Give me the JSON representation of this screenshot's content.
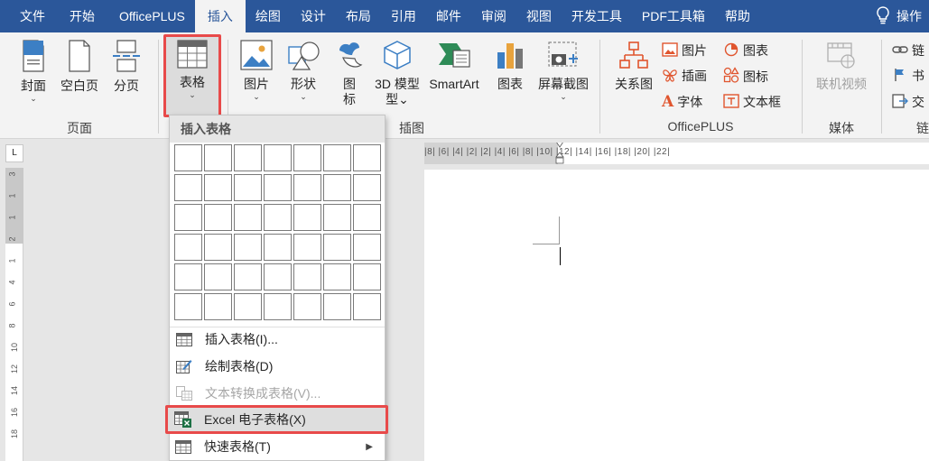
{
  "menubar": {
    "tabs": [
      "文件",
      "开始",
      "OfficePLUS",
      "插入",
      "绘图",
      "设计",
      "布局",
      "引用",
      "邮件",
      "审阅",
      "视图",
      "开发工具",
      "PDF工具箱",
      "帮助"
    ],
    "active_tab": "插入",
    "tell_me": "操作"
  },
  "ribbon": {
    "pages": {
      "cover": "封面",
      "blank": "空白页",
      "break": "分页",
      "group": "页面"
    },
    "table": {
      "label": "表格"
    },
    "illustrations": {
      "picture": "图片",
      "shapes": "形状",
      "icons": "图标",
      "model3d": "3D 模型",
      "smartart": "SmartArt",
      "chart": "图表",
      "screenshot": "屏幕截图",
      "group": "插图"
    },
    "officeplus": {
      "relation": "关系图",
      "picture": "图片",
      "illustration": "插画",
      "font": "字体",
      "chart": "图表",
      "icon": "图标",
      "textbox": "文本框",
      "group": "OfficePLUS"
    },
    "media": {
      "online_video": "联机视频",
      "group": "媒体"
    },
    "links": {
      "link": "链",
      "bookmark": "书",
      "cross": "交",
      "group": "链"
    }
  },
  "dropdown": {
    "header": "插入表格",
    "items": [
      {
        "label": "插入表格(I)...",
        "enabled": true
      },
      {
        "label": "绘制表格(D)",
        "enabled": true
      },
      {
        "label": "文本转换成表格(V)...",
        "enabled": false
      },
      {
        "label": "Excel 电子表格(X)",
        "enabled": true
      },
      {
        "label": "快速表格(T)",
        "enabled": true
      }
    ]
  },
  "rulers": {
    "horizontal": "|8|  |6|  |4|  |2|       |2|  |4|  |6|  |8|  |10|  |12|  |14|  |16|  |18|  |20|  |22|",
    "vertical": [
      "3",
      "1",
      "1",
      "2",
      "1",
      "4",
      "6",
      "8",
      "10",
      "12",
      "14",
      "16",
      "18"
    ]
  },
  "colors": {
    "brand": "#2b579a",
    "highlight": "#e84a4a",
    "excel_green": "#1d7044"
  }
}
